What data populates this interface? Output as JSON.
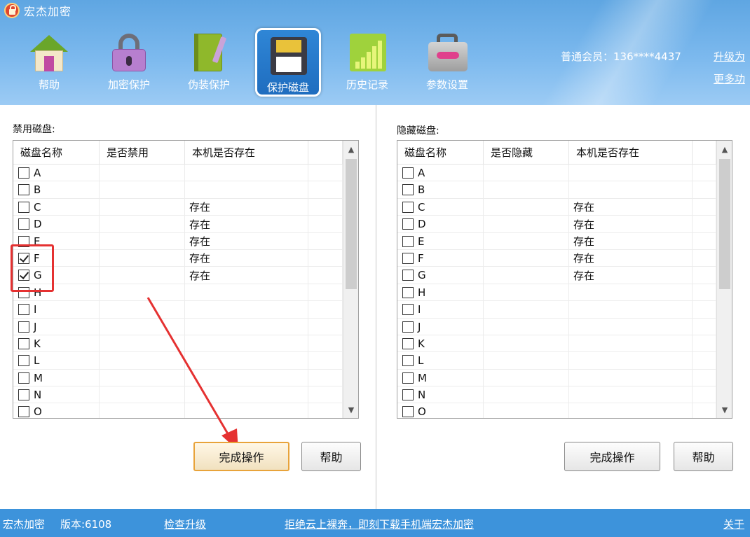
{
  "window": {
    "title": "宏杰加密"
  },
  "toolbar": [
    {
      "label": "帮助",
      "icon": "home-icon"
    },
    {
      "label": "加密保护",
      "icon": "lock-icon"
    },
    {
      "label": "伪装保护",
      "icon": "book-icon"
    },
    {
      "label": "保护磁盘",
      "icon": "floppy-disk-icon",
      "active": true
    },
    {
      "label": "历史记录",
      "icon": "bar-chart-icon"
    },
    {
      "label": "参数设置",
      "icon": "toolbox-icon"
    }
  ],
  "account": {
    "member": "普通会员：136****4437",
    "upgrade": "升级为",
    "more": "更多功"
  },
  "disable_panel": {
    "title": "禁用磁盘:",
    "columns": [
      "磁盘名称",
      "是否禁用",
      "本机是否存在"
    ],
    "rows": [
      {
        "name": "A",
        "checked": false,
        "status": "",
        "exists": ""
      },
      {
        "name": "B",
        "checked": false,
        "status": "",
        "exists": ""
      },
      {
        "name": "C",
        "checked": false,
        "status": "",
        "exists": "存在"
      },
      {
        "name": "D",
        "checked": false,
        "status": "",
        "exists": "存在"
      },
      {
        "name": "E",
        "checked": false,
        "status": "",
        "exists": "存在"
      },
      {
        "name": "F",
        "checked": true,
        "status": "",
        "exists": "存在"
      },
      {
        "name": "G",
        "checked": true,
        "status": "",
        "exists": "存在"
      },
      {
        "name": "H",
        "checked": false,
        "status": "",
        "exists": ""
      },
      {
        "name": "I",
        "checked": false,
        "status": "",
        "exists": ""
      },
      {
        "name": "J",
        "checked": false,
        "status": "",
        "exists": ""
      },
      {
        "name": "K",
        "checked": false,
        "status": "",
        "exists": ""
      },
      {
        "name": "L",
        "checked": false,
        "status": "",
        "exists": ""
      },
      {
        "name": "M",
        "checked": false,
        "status": "",
        "exists": ""
      },
      {
        "name": "N",
        "checked": false,
        "status": "",
        "exists": ""
      },
      {
        "name": "O",
        "checked": false,
        "status": "",
        "exists": ""
      }
    ],
    "confirm_label": "完成操作",
    "help_label": "帮助"
  },
  "hide_panel": {
    "title": "隐藏磁盘:",
    "columns": [
      "磁盘名称",
      "是否隐藏",
      "本机是否存在"
    ],
    "rows": [
      {
        "name": "A",
        "checked": false,
        "status": "",
        "exists": ""
      },
      {
        "name": "B",
        "checked": false,
        "status": "",
        "exists": ""
      },
      {
        "name": "C",
        "checked": false,
        "status": "",
        "exists": "存在"
      },
      {
        "name": "D",
        "checked": false,
        "status": "",
        "exists": "存在"
      },
      {
        "name": "E",
        "checked": false,
        "status": "",
        "exists": "存在"
      },
      {
        "name": "F",
        "checked": false,
        "status": "",
        "exists": "存在"
      },
      {
        "name": "G",
        "checked": false,
        "status": "",
        "exists": "存在"
      },
      {
        "name": "H",
        "checked": false,
        "status": "",
        "exists": ""
      },
      {
        "name": "I",
        "checked": false,
        "status": "",
        "exists": ""
      },
      {
        "name": "J",
        "checked": false,
        "status": "",
        "exists": ""
      },
      {
        "name": "K",
        "checked": false,
        "status": "",
        "exists": ""
      },
      {
        "name": "L",
        "checked": false,
        "status": "",
        "exists": ""
      },
      {
        "name": "M",
        "checked": false,
        "status": "",
        "exists": ""
      },
      {
        "name": "N",
        "checked": false,
        "status": "",
        "exists": ""
      },
      {
        "name": "O",
        "checked": false,
        "status": "",
        "exists": ""
      }
    ],
    "confirm_label": "完成操作",
    "help_label": "帮助"
  },
  "footer": {
    "app_name": "宏杰加密",
    "version": "版本:6108",
    "check_update": "检查升级",
    "promo": "拒绝云上裸奔，即刻下载手机端宏杰加密",
    "about": "关于"
  },
  "colors": {
    "header_blue": "#7cb9ee",
    "footer_blue": "#3d93db",
    "highlight_red": "#e53131",
    "focus_orange": "#e8a33a"
  }
}
